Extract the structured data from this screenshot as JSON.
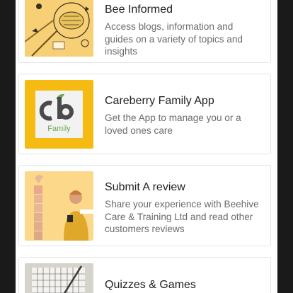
{
  "cards": [
    {
      "title": "Bee Informed",
      "description": "Access blogs, information and guides on a variety of topics and insights",
      "thumb_bg": "#f7cf74"
    },
    {
      "title": "Careberry Family App",
      "description": "Get the App to manage you or a loved ones care",
      "thumb_bg": "#f6bb12",
      "logo_text": "Family"
    },
    {
      "title": "Submit A review",
      "description": "Share your experience with Beehive Care & Training Ltd and read other customers reviews",
      "thumb_bg": "#fbd88a"
    },
    {
      "title": "Quizzes & Games",
      "description": "",
      "thumb_bg": "#d6d2cc"
    }
  ]
}
